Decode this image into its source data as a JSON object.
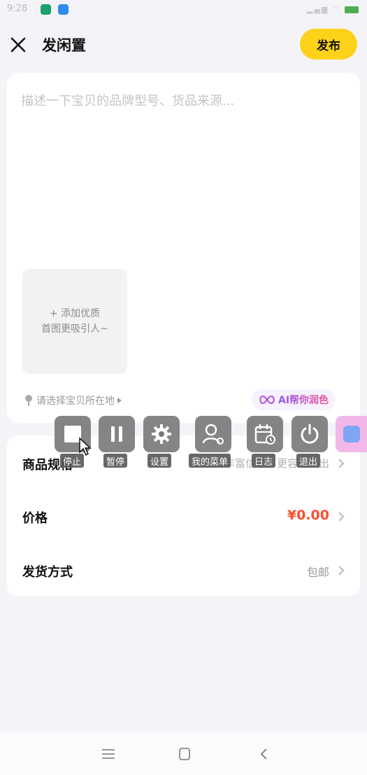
{
  "status_bar": {
    "time": "9:28"
  },
  "header": {
    "title": "发闲置",
    "publish_label": "发布"
  },
  "description": {
    "placeholder": "描述一下宝贝的品牌型号、货品来源...",
    "add_photo_line1": "+ 添加优质",
    "add_photo_line2": "首图更吸引人~",
    "location_label": "请选择宝贝所在地",
    "ai_label": "AI帮你润色"
  },
  "properties": {
    "spec": {
      "label": "商品规格",
      "hint": "丰富信息，更容易卖出"
    },
    "price": {
      "label": "价格",
      "value": "¥0.00"
    },
    "shipping": {
      "label": "发货方式",
      "value": "包邮"
    }
  },
  "float_toolbar": {
    "items": [
      {
        "label": "停止",
        "icon": "stop-icon"
      },
      {
        "label": "暂停",
        "icon": "pause-icon"
      },
      {
        "label": "设置",
        "icon": "gear-icon"
      },
      {
        "label": "我的菜单",
        "icon": "user-gear-icon"
      },
      {
        "label": "日志",
        "icon": "calendar-clock-icon"
      },
      {
        "label": "退出",
        "icon": "power-icon"
      }
    ]
  },
  "colors": {
    "accent": "#ffd21a",
    "price": "#ff4d2e",
    "background": "#f4f3f8"
  }
}
